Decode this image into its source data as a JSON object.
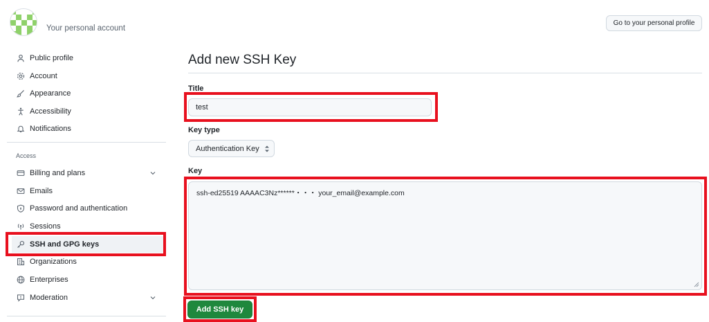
{
  "header": {
    "account_label": "Your personal account",
    "profile_button": "Go to your personal profile"
  },
  "sidebar": {
    "items": [
      {
        "label": "Public profile",
        "icon": "person-icon"
      },
      {
        "label": "Account",
        "icon": "gear-icon"
      },
      {
        "label": "Appearance",
        "icon": "paintbrush-icon"
      },
      {
        "label": "Accessibility",
        "icon": "accessibility-icon"
      },
      {
        "label": "Notifications",
        "icon": "bell-icon"
      }
    ],
    "access_label": "Access",
    "access_items": [
      {
        "label": "Billing and plans",
        "icon": "credit-card-icon",
        "expandable": true
      },
      {
        "label": "Emails",
        "icon": "mail-icon"
      },
      {
        "label": "Password and authentication",
        "icon": "shield-lock-icon"
      },
      {
        "label": "Sessions",
        "icon": "broadcast-icon"
      },
      {
        "label": "SSH and GPG keys",
        "icon": "key-icon",
        "active": true
      },
      {
        "label": "Organizations",
        "icon": "organization-icon"
      },
      {
        "label": "Enterprises",
        "icon": "globe-icon"
      },
      {
        "label": "Moderation",
        "icon": "report-icon",
        "expandable": true
      }
    ]
  },
  "main": {
    "title": "Add new SSH Key",
    "title_field_label": "Title",
    "title_value": "test",
    "key_type_label": "Key type",
    "key_type_value": "Authentication Key",
    "key_label": "Key",
    "key_value": "ssh-ed25519 AAAAC3Nz******・・・ your_email@example.com",
    "submit_label": "Add SSH key"
  },
  "colors": {
    "highlight": "#e8101e",
    "primary_button": "#1f883d",
    "active_nav_bg": "#eff2f5"
  }
}
